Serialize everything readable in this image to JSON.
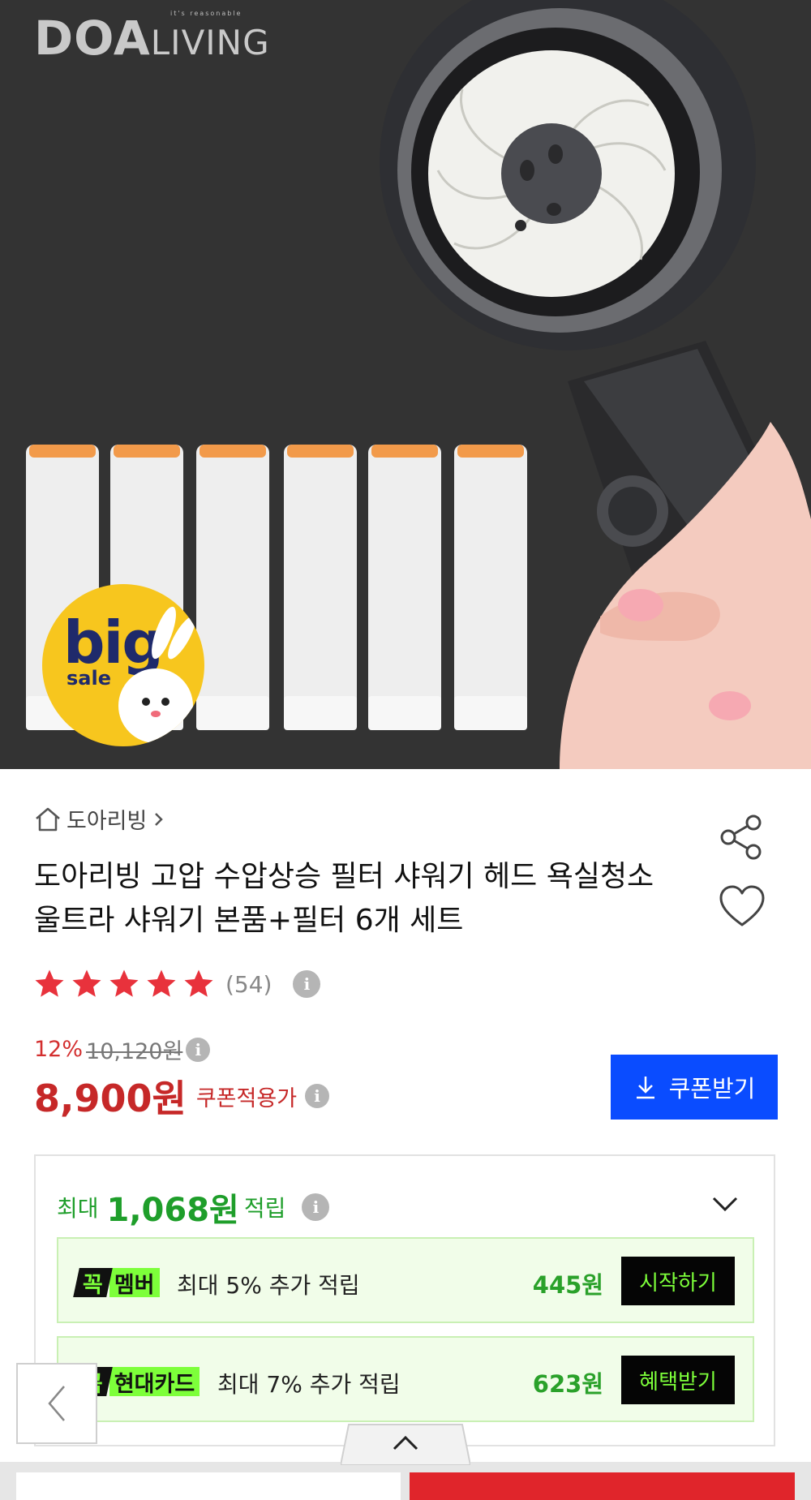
{
  "hero": {
    "brand_tagline": "it's reasonable",
    "brand_main": "DOA",
    "brand_sub": "LIVING",
    "badge_big": "big",
    "badge_sale": "sale"
  },
  "breadcrumb": {
    "store": "도아리빙",
    "home_icon": "home-icon",
    "chevron_icon": "chevron-right-icon"
  },
  "product": {
    "title": "도아리빙 고압 수압상승 필터 샤워기 헤드 욕실청소 울트라 샤워기 본품+필터 6개 세트",
    "rating_stars": 5,
    "review_count": "(54)",
    "discount_rate": "12%",
    "original_price": "10,120원",
    "price": "8,900원",
    "price_label": "쿠폰적용가"
  },
  "actions": {
    "coupon_button": "쿠폰받기",
    "coupon_icon": "download-icon",
    "share_icon": "share-icon",
    "like_icon": "heart-icon"
  },
  "points": {
    "prefix": "최대",
    "amount": "1,068원",
    "suffix": "적립",
    "benefits": [
      {
        "badge_kok": "꼭",
        "badge_name": "멤버",
        "text": "최대 5% 추가 적립",
        "amount": "445원",
        "button": "시작하기"
      },
      {
        "badge_kok": "꼭",
        "badge_name": "현대카드",
        "text": "최대 7% 추가 적립",
        "amount": "623원",
        "button": "혜택받기"
      }
    ]
  },
  "colors": {
    "accent_blue": "#0a4cff",
    "price_red": "#c62828",
    "point_green": "#1e9e2a",
    "kok_green": "#7dff3a",
    "buy_red": "#e0252b"
  }
}
